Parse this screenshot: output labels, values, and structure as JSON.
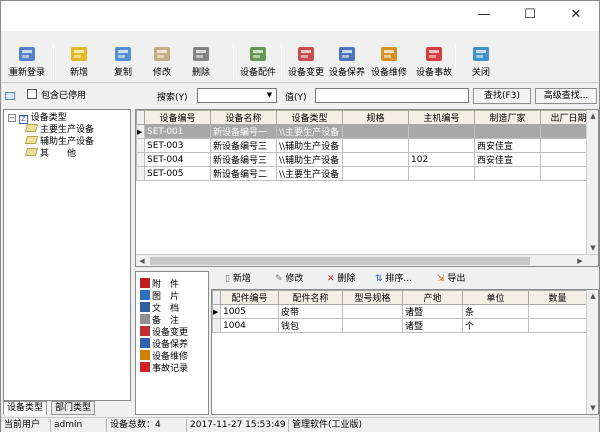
{
  "window": {
    "minimize": "—",
    "maximize": "☐",
    "close": "✕"
  },
  "toolbar": [
    {
      "label": "重新登录",
      "icon": "relogin-icon",
      "color": "#3a6fbf"
    },
    {
      "label": "新增",
      "icon": "new-icon",
      "color": "#e0b000"
    },
    {
      "label": "复制",
      "icon": "copy-icon",
      "color": "#3a7fd0"
    },
    {
      "label": "修改",
      "icon": "edit-icon",
      "color": "#c0a070"
    },
    {
      "label": "删除",
      "icon": "delete-icon",
      "color": "#707070"
    },
    {
      "label": "设备配件",
      "icon": "parts-icon",
      "color": "#4a8a3a"
    },
    {
      "label": "设备变更",
      "icon": "change-icon",
      "color": "#c03030"
    },
    {
      "label": "设备保养",
      "icon": "maintain-icon",
      "color": "#3060b0"
    },
    {
      "label": "设备维修",
      "icon": "repair-icon",
      "color": "#d08000"
    },
    {
      "label": "设备事故",
      "icon": "accident-icon",
      "color": "#d02020"
    },
    {
      "label": "关闭",
      "icon": "close-door-icon",
      "color": "#2080c0"
    }
  ],
  "filter": {
    "include_disabled": "包含已停用",
    "search_label": "搜索(Y)",
    "search_value": "",
    "value_label": "值(Y)",
    "value_input": "",
    "find_button": "查找(F3)",
    "advanced_button": "高级查找..."
  },
  "tree": {
    "root": "设备类型",
    "children": [
      "主要生产设备",
      "辅助生产设备",
      "其　　他"
    ]
  },
  "left_tabs": [
    "设备类型",
    "部门类型"
  ],
  "main_table": {
    "columns": [
      "设备编号",
      "设备名称",
      "设备类型",
      "规格",
      "主机编号",
      "制造厂家",
      "出厂日期"
    ],
    "rows": [
      [
        "SET-001",
        "新设备编号一",
        "\\\\主要生产设备",
        "",
        "",
        "",
        ""
      ],
      [
        "SET-003",
        "新设备编号三",
        "\\\\辅助生产设备",
        "",
        "",
        "西安佳宣",
        ""
      ],
      [
        "SET-004",
        "新设备编号三",
        "\\\\辅助生产设备",
        "",
        "102",
        "西安佳宣",
        ""
      ],
      [
        "SET-005",
        "新设备编号二",
        "\\\\主要生产设备",
        "",
        "",
        "",
        ""
      ]
    ]
  },
  "attach_list": [
    {
      "label": "附　件",
      "color": "#c02020"
    },
    {
      "label": "图　片",
      "color": "#3070c0"
    },
    {
      "label": "文　档",
      "color": "#3060a0"
    },
    {
      "label": "备　注",
      "color": "#909090"
    },
    {
      "label": "设备变更",
      "color": "#c03030"
    },
    {
      "label": "设备保养",
      "color": "#3060b0"
    },
    {
      "label": "设备维修",
      "color": "#d08000"
    },
    {
      "label": "事故记录",
      "color": "#d02020"
    }
  ],
  "sub_toolbar": {
    "new": "新增",
    "edit": "修改",
    "delete": "删除",
    "sort": "排序...",
    "export": "导出"
  },
  "parts_table": {
    "columns": [
      "配件编号",
      "配件名称",
      "型号规格",
      "产地",
      "单位",
      "数量"
    ],
    "rows": [
      [
        "1005",
        "皮带",
        "",
        "诸暨",
        "条",
        ""
      ],
      [
        "1004",
        "钱包",
        "",
        "诸暨",
        "个",
        ""
      ]
    ]
  },
  "status": {
    "user_label": "当前用户",
    "user": "admin",
    "total": "设备总数：4",
    "datetime": "2017-11-27  15:53:49",
    "app": "管理软件(工业版)"
  }
}
